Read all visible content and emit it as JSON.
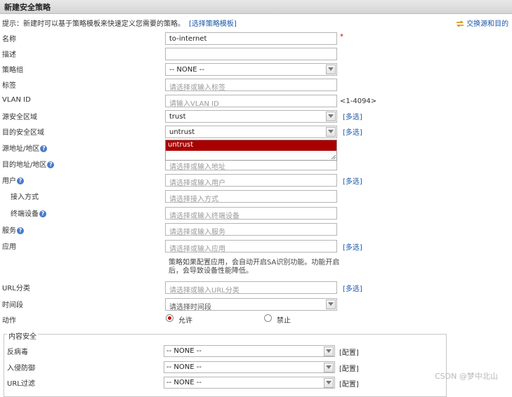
{
  "window": {
    "title": "新建安全策略"
  },
  "tip": {
    "text": "提示：新建时可以基于策略模板来快速定义您需要的策略。",
    "link": "[选择策略模板]"
  },
  "swap_link": "交换源和目的",
  "form": {
    "name": {
      "label": "名称",
      "value": "to-internet",
      "required": "*"
    },
    "description": {
      "label": "描述",
      "value": ""
    },
    "policy_group": {
      "label": "策略组",
      "value": "-- NONE --"
    },
    "tag": {
      "label": "标签",
      "placeholder": "请选择或输入标签"
    },
    "vlan": {
      "label": "VLAN ID",
      "placeholder": "请输入VLAN ID",
      "hint": "<1-4094>"
    },
    "src_zone": {
      "label": "源安全区域",
      "value": "trust",
      "multi": "[多选]"
    },
    "dst_zone": {
      "label": "目的安全区域",
      "value": "untrust",
      "multi": "[多选]"
    },
    "dst_zone_dropdown": {
      "options": [
        "untrust"
      ]
    },
    "src_addr": {
      "label": "源地址/地区"
    },
    "dst_addr": {
      "label": "目的地址/地区",
      "placeholder": "请选择或输入地址"
    },
    "user": {
      "label": "用户",
      "placeholder": "请选择或输入用户",
      "multi": "[多选]"
    },
    "access_method": {
      "label": "接入方式",
      "placeholder": "请选择接入方式"
    },
    "terminal": {
      "label": "终端设备",
      "placeholder": "请选择或输入终端设备"
    },
    "service": {
      "label": "服务",
      "placeholder": "请选择或输入服务"
    },
    "application": {
      "label": "应用",
      "placeholder": "请选择或输入应用",
      "multi": "[多选]",
      "note": "策略如果配置应用，会自动开启SA识别功能。功能开启后，会导致设备性能降低。"
    },
    "url_category": {
      "label": "URL分类",
      "placeholder": "请选择或输入URL分类",
      "multi": "[多选]"
    },
    "time_range": {
      "label": "时间段",
      "placeholder": "请选择时间段"
    },
    "action": {
      "label": "动作",
      "permit": "允许",
      "deny": "禁止",
      "selected": "permit"
    }
  },
  "content_security": {
    "legend": "内容安全",
    "antivirus": {
      "label": "反病毒",
      "value": "-- NONE --",
      "config": "[配置]"
    },
    "ips": {
      "label": "入侵防御",
      "value": "-- NONE --",
      "config": "[配置]"
    },
    "url_filter": {
      "label": "URL过滤",
      "value": "-- NONE --",
      "config": "[配置]"
    }
  },
  "help_glyph": "?",
  "watermark": "CSDN @梦中北山",
  "colors": {
    "selected_option": "#a80000",
    "link": "#1a57a8",
    "required": "#d00000"
  }
}
